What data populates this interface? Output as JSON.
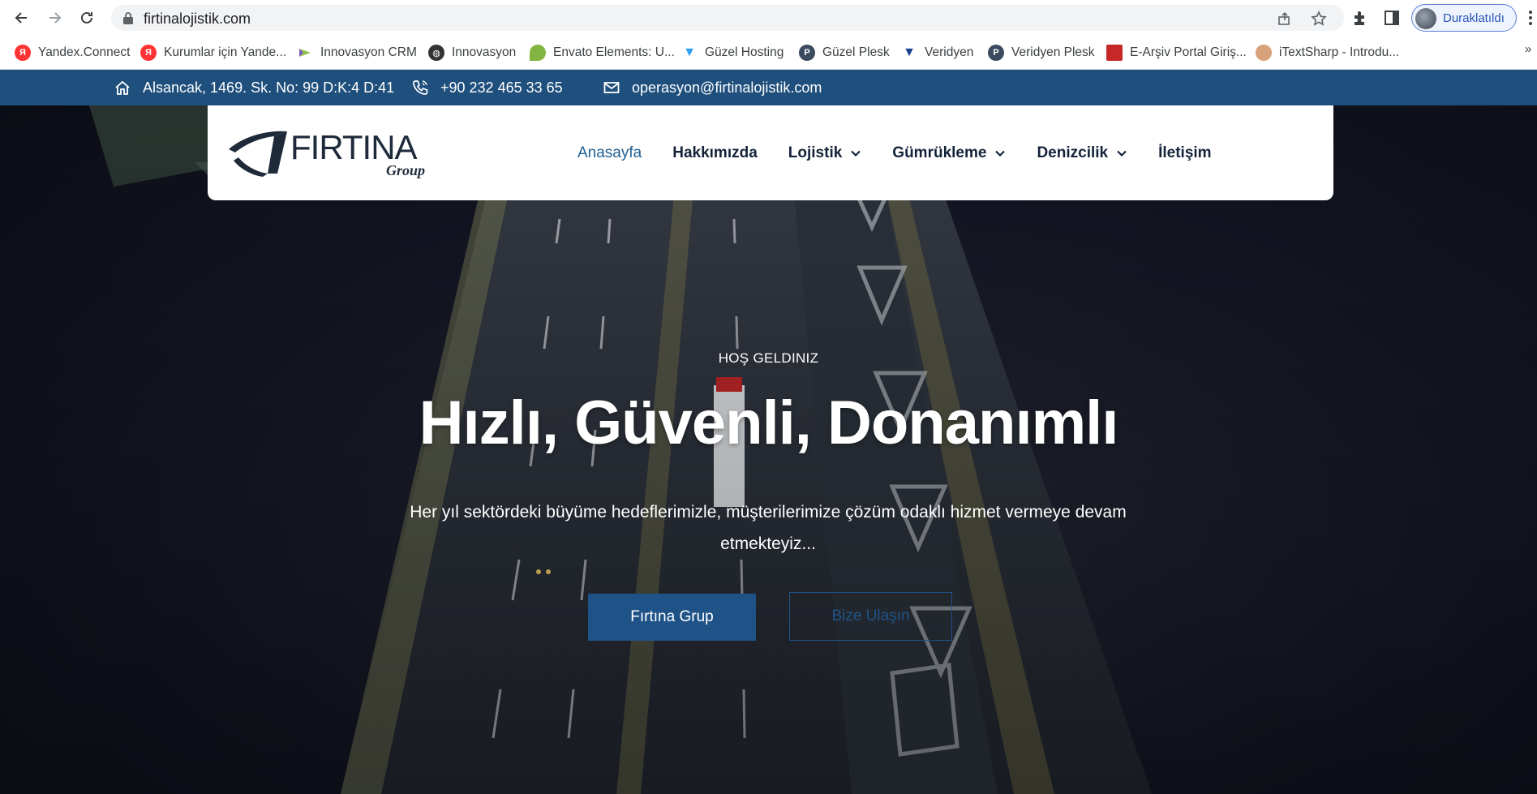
{
  "browser": {
    "url": "firtinalojistik.com",
    "profile_label": "Duraklatıldı",
    "bookmarks": [
      {
        "label": "Yandex.Connect",
        "icon": "yandex-icon",
        "color": "#f33"
      },
      {
        "label": "Kurumlar için Yande...",
        "icon": "yandex-icon",
        "color": "#f33"
      },
      {
        "label": "Innovasyon CRM",
        "icon": "innovasyon-icon",
        "color": "#8bc34a"
      },
      {
        "label": "Innovasyon",
        "icon": "globe-icon",
        "color": "#333"
      },
      {
        "label": "Envato Elements: U...",
        "icon": "envato-icon",
        "color": "#82b541"
      },
      {
        "label": "Güzel Hosting",
        "icon": "hosting-icon",
        "color": "#2a9df4"
      },
      {
        "label": "Güzel Plesk",
        "icon": "plesk-icon",
        "color": "#3b4a5e"
      },
      {
        "label": "Veridyen",
        "icon": "veridyen-icon",
        "color": "#1b3f8f"
      },
      {
        "label": "Veridyen Plesk",
        "icon": "plesk-icon",
        "color": "#3b4a5e"
      },
      {
        "label": "E-Arşiv Portal Giriş...",
        "icon": "earsiv-icon",
        "color": "#c62828"
      },
      {
        "label": "iTextSharp - Introdu...",
        "icon": "itextsharp-icon",
        "color": "#d7a17a"
      }
    ],
    "bookmarks_more": "»"
  },
  "topbar": {
    "address": "Alsancak, 1469. Sk. No: 99 D:K:4 D:41",
    "phone": "+90 232 465 33 65",
    "email": "operasyon@firtinalojistik.com"
  },
  "logo": {
    "name": "FIRTINA",
    "tagline": "Group"
  },
  "nav": [
    {
      "label": "Anasayfa",
      "active": true,
      "dropdown": false
    },
    {
      "label": "Hakkımızda",
      "active": false,
      "dropdown": false
    },
    {
      "label": "Lojistik",
      "active": false,
      "dropdown": true
    },
    {
      "label": "Gümrükleme",
      "active": false,
      "dropdown": true
    },
    {
      "label": "Denizcilik",
      "active": false,
      "dropdown": true
    },
    {
      "label": "İletişim",
      "active": false,
      "dropdown": false
    }
  ],
  "hero": {
    "eyebrow": "HOŞ GELDINIZ",
    "headline": "Hızlı, Güvenli, Donanımlı",
    "lead": "Her yıl sektördeki büyüme hedeflerimizle, müşterilerimize çözüm odaklı hizmet vermeye devam etmekteyiz...",
    "primary_button": "Fırtına Grup",
    "secondary_button": "Bize Ulaşın"
  },
  "colors": {
    "brand": "#1f4f7d",
    "button": "#1f5388",
    "nav_active": "#1f5f93"
  }
}
